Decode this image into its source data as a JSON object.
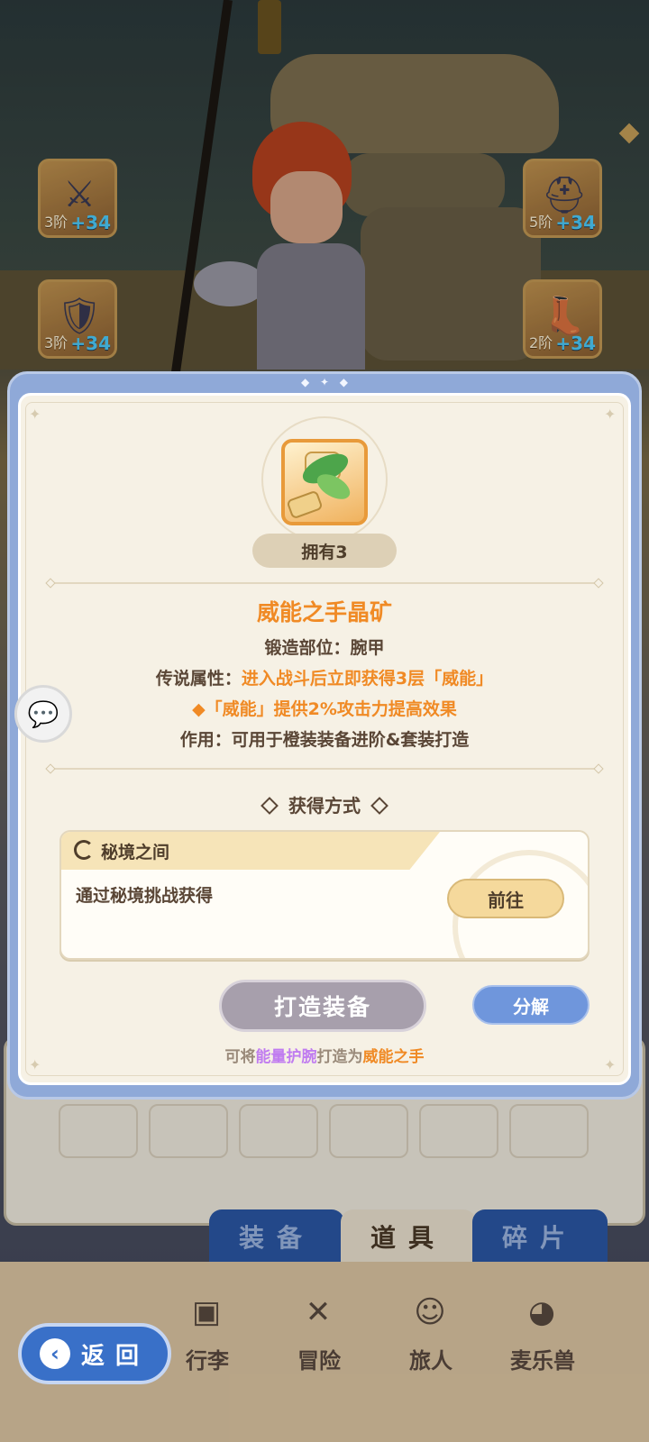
{
  "equipment_slots": [
    {
      "tier": "3阶",
      "bonus": "+34",
      "icon": "spear-icon",
      "glyph": "⚔"
    },
    {
      "tier": "5阶",
      "bonus": "+34",
      "icon": "helmet-icon",
      "glyph": "⛑"
    },
    {
      "tier": "3阶",
      "bonus": "+34",
      "icon": "armor-icon",
      "glyph": "🛡"
    },
    {
      "tier": "2阶",
      "bonus": "+34",
      "icon": "boots-icon",
      "glyph": "👢"
    }
  ],
  "item": {
    "owned": "拥有3",
    "name": "威能之手晶矿",
    "forge_slot": "锻造部位：腕甲",
    "legend_label": "传说属性：",
    "legend_value": "进入战斗后立即获得3层「威能」",
    "effect_line": "◆「威能」提供2%攻击力提高效果",
    "usage": "作用：可用于橙装装备进阶&套装打造"
  },
  "obtain": {
    "heading": "获得方式",
    "source_name": "秘境之间",
    "source_desc": "通过秘境挑战获得",
    "goto_label": "前往"
  },
  "actions": {
    "forge_label": "打造装备",
    "decompose_label": "分解"
  },
  "hint": {
    "prefix": "可将",
    "material": "能量护腕",
    "middle": "打造为",
    "result": "威能之手"
  },
  "tabs": [
    {
      "label": "装备",
      "active": false
    },
    {
      "label": "道具",
      "active": true
    },
    {
      "label": "碎片",
      "active": false
    }
  ],
  "bottom_nav": [
    {
      "label": "行李",
      "icon": "luggage-icon"
    },
    {
      "label": "冒险",
      "icon": "crossed-swords-icon"
    },
    {
      "label": "旅人",
      "icon": "traveler-icon"
    },
    {
      "label": "麦乐兽",
      "icon": "pet-icon"
    }
  ],
  "back_label": "返回",
  "colors": {
    "accent_orange": "#f08a25",
    "modal_border_blue": "#8fa9d8",
    "decompose_blue": "#6f96dc",
    "material_purple": "#c07cf0"
  }
}
